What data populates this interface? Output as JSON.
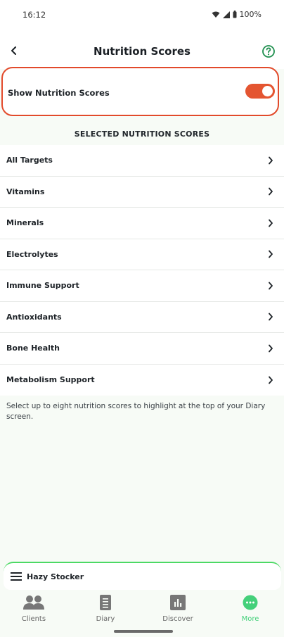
{
  "status": {
    "time": "16:12",
    "battery": "100%"
  },
  "header": {
    "title": "Nutrition Scores"
  },
  "toggle": {
    "label": "Show Nutrition Scores",
    "enabled": true
  },
  "section_title": "SELECTED NUTRITION SCORES",
  "items": [
    {
      "label": "All Targets"
    },
    {
      "label": "Vitamins"
    },
    {
      "label": "Minerals"
    },
    {
      "label": "Electrolytes"
    },
    {
      "label": "Immune Support"
    },
    {
      "label": "Antioxidants"
    },
    {
      "label": "Bone Health"
    },
    {
      "label": "Metabolism Support"
    }
  ],
  "help_text": "Select up to eight nutrition scores to highlight at the top of your Diary screen.",
  "bottom_sheet": {
    "name": "Hazy Stocker"
  },
  "tabs": [
    {
      "label": "Clients",
      "icon": "clients-icon"
    },
    {
      "label": "Diary",
      "icon": "diary-icon"
    },
    {
      "label": "Discover",
      "icon": "discover-icon"
    },
    {
      "label": "More",
      "icon": "more-icon",
      "active": true
    }
  ],
  "colors": {
    "accent": "#e45531",
    "active_tab": "#44d07a",
    "sheet_border": "#4cd964"
  }
}
